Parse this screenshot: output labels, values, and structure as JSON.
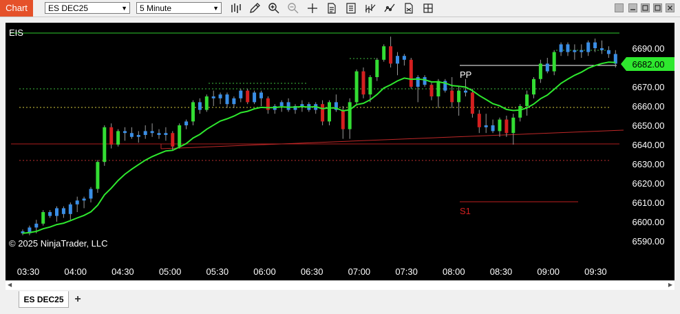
{
  "toolbar": {
    "chart_tab": "Chart",
    "instrument": "ES DEC25",
    "interval": "5 Minute",
    "icons": [
      "bar-type-icon",
      "drawing-pencil-icon",
      "zoom-in-icon",
      "zoom-out-icon",
      "crosshair-icon",
      "data-box-icon",
      "properties-icon",
      "indicators-icon",
      "strategies-icon",
      "templates-icon"
    ]
  },
  "chart": {
    "label": "EIS",
    "copyright": "© 2025 NinjaTrader, LLC",
    "pp_label": "PP",
    "s1_label": "S1",
    "current_price": "6682.00",
    "colors": {
      "up": "#3a8ee6",
      "down": "#d41f1f",
      "strong_up": "#33dd33",
      "ma": "#2ee82e",
      "price_tag": "#2ee82e"
    }
  },
  "chart_data": {
    "type": "candlestick",
    "instrument": "ES DEC25",
    "interval": "5 Minute",
    "y_ticks": [
      "6690.00",
      "6680.00",
      "6670.00",
      "6660.00",
      "6650.00",
      "6640.00",
      "6630.00",
      "6620.00",
      "6610.00",
      "6600.00",
      "6590.00"
    ],
    "x_ticks": [
      "03:30",
      "04:00",
      "04:30",
      "05:00",
      "05:30",
      "06:00",
      "06:30",
      "07:00",
      "07:30",
      "08:00",
      "08:30",
      "09:00",
      "09:30"
    ],
    "ylim": [
      6584.5,
      6697.5
    ],
    "levels": {
      "eis": 6695.5,
      "pp": 6681,
      "s1": 6611
    },
    "candles": [
      [
        6595,
        6596,
        6593,
        6594
      ],
      [
        6594,
        6598,
        6593,
        6597
      ],
      [
        6597,
        6601,
        6594,
        6599
      ],
      [
        6599,
        6606,
        6598,
        6605
      ],
      [
        6605,
        6606,
        6602,
        6603
      ],
      [
        6603,
        6608,
        6600,
        6607
      ],
      [
        6607,
        6608,
        6602,
        6604
      ],
      [
        6604,
        6610,
        6601,
        6609
      ],
      [
        6609,
        6613,
        6605,
        6611
      ],
      [
        6611,
        6613,
        6607,
        6612
      ],
      [
        6612,
        6618,
        6610,
        6617
      ],
      [
        6617,
        6632,
        6615,
        6631
      ],
      [
        6631,
        6650,
        6629,
        6649
      ],
      [
        6649,
        6651,
        6638,
        6640
      ],
      [
        6640,
        6648,
        6639,
        6647
      ],
      [
        6647,
        6649,
        6642,
        6646
      ],
      [
        6646,
        6649,
        6643,
        6644
      ],
      [
        6644,
        6647,
        6641,
        6645
      ],
      [
        6645,
        6650,
        6643,
        6647
      ],
      [
        6647,
        6651,
        6644,
        6646
      ],
      [
        6646,
        6648,
        6643,
        6645
      ],
      [
        6645,
        6649,
        6642,
        6646
      ],
      [
        6646,
        6647,
        6637,
        6639
      ],
      [
        6639,
        6651,
        6638,
        6650
      ],
      [
        6650,
        6653,
        6648,
        6652
      ],
      [
        6652,
        6663,
        6650,
        6662
      ],
      [
        6662,
        6664,
        6656,
        6658
      ],
      [
        6658,
        6666,
        6657,
        6665
      ],
      [
        6665,
        6668,
        6660,
        6664
      ],
      [
        6664,
        6667,
        6661,
        6666
      ],
      [
        6666,
        6667,
        6659,
        6661
      ],
      [
        6661,
        6665,
        6659,
        6664
      ],
      [
        6664,
        6669,
        6662,
        6668
      ],
      [
        6668,
        6669,
        6661,
        6662
      ],
      [
        6662,
        6668,
        6661,
        6667
      ],
      [
        6667,
        6668,
        6660,
        6664
      ],
      [
        6664,
        6665,
        6656,
        6658
      ],
      [
        6658,
        6661,
        6656,
        6660
      ],
      [
        6660,
        6663,
        6657,
        6662
      ],
      [
        6662,
        6664,
        6657,
        6658
      ],
      [
        6658,
        6661,
        6656,
        6660
      ],
      [
        6660,
        6663,
        6657,
        6661
      ],
      [
        6661,
        6662,
        6657,
        6658
      ],
      [
        6658,
        6662,
        6656,
        6661
      ],
      [
        6661,
        6663,
        6650,
        6652
      ],
      [
        6652,
        6663,
        6650,
        6662
      ],
      [
        6662,
        6666,
        6657,
        6658
      ],
      [
        6658,
        6660,
        6643,
        6648
      ],
      [
        6648,
        6664,
        6643,
        6662
      ],
      [
        6662,
        6679,
        6661,
        6678
      ],
      [
        6678,
        6680,
        6664,
        6666
      ],
      [
        6666,
        6676,
        6662,
        6675
      ],
      [
        6675,
        6685,
        6673,
        6684
      ],
      [
        6684,
        6692,
        6683,
        6691
      ],
      [
        6691,
        6696,
        6680,
        6682
      ],
      [
        6682,
        6688,
        6676,
        6686
      ],
      [
        6686,
        6687,
        6681,
        6684
      ],
      [
        6684,
        6685,
        6669,
        6670
      ],
      [
        6670,
        6676,
        6662,
        6675
      ],
      [
        6675,
        6676,
        6670,
        6671
      ],
      [
        6671,
        6672,
        6663,
        6665
      ],
      [
        6665,
        6674,
        6659,
        6673
      ],
      [
        6673,
        6674,
        6667,
        6668
      ],
      [
        6668,
        6675,
        6659,
        6662
      ],
      [
        6662,
        6670,
        6655,
        6668
      ],
      [
        6668,
        6674,
        6665,
        6667
      ],
      [
        6667,
        6669,
        6654,
        6656
      ],
      [
        6656,
        6658,
        6646,
        6649
      ],
      [
        6649,
        6656,
        6646,
        6650
      ],
      [
        6650,
        6653,
        6646,
        6647
      ],
      [
        6647,
        6654,
        6644,
        6653
      ],
      [
        6653,
        6655,
        6644,
        6646
      ],
      [
        6646,
        6656,
        6640,
        6654
      ],
      [
        6654,
        6661,
        6652,
        6660
      ],
      [
        6660,
        6668,
        6655,
        6666
      ],
      [
        6666,
        6675,
        6664,
        6674
      ],
      [
        6674,
        6684,
        6672,
        6682
      ],
      [
        6682,
        6685,
        6677,
        6678
      ],
      [
        6678,
        6689,
        6676,
        6688
      ],
      [
        6688,
        6693,
        6686,
        6692
      ],
      [
        6692,
        6693,
        6686,
        6688
      ],
      [
        6688,
        6692,
        6684,
        6689
      ],
      [
        6689,
        6692,
        6685,
        6688
      ],
      [
        6688,
        6694,
        6686,
        6693
      ],
      [
        6693,
        6695,
        6688,
        6690
      ],
      [
        6690,
        6694,
        6687,
        6689
      ],
      [
        6689,
        6691,
        6685,
        6687
      ],
      [
        6687,
        6689,
        6680,
        6682
      ]
    ]
  }
}
